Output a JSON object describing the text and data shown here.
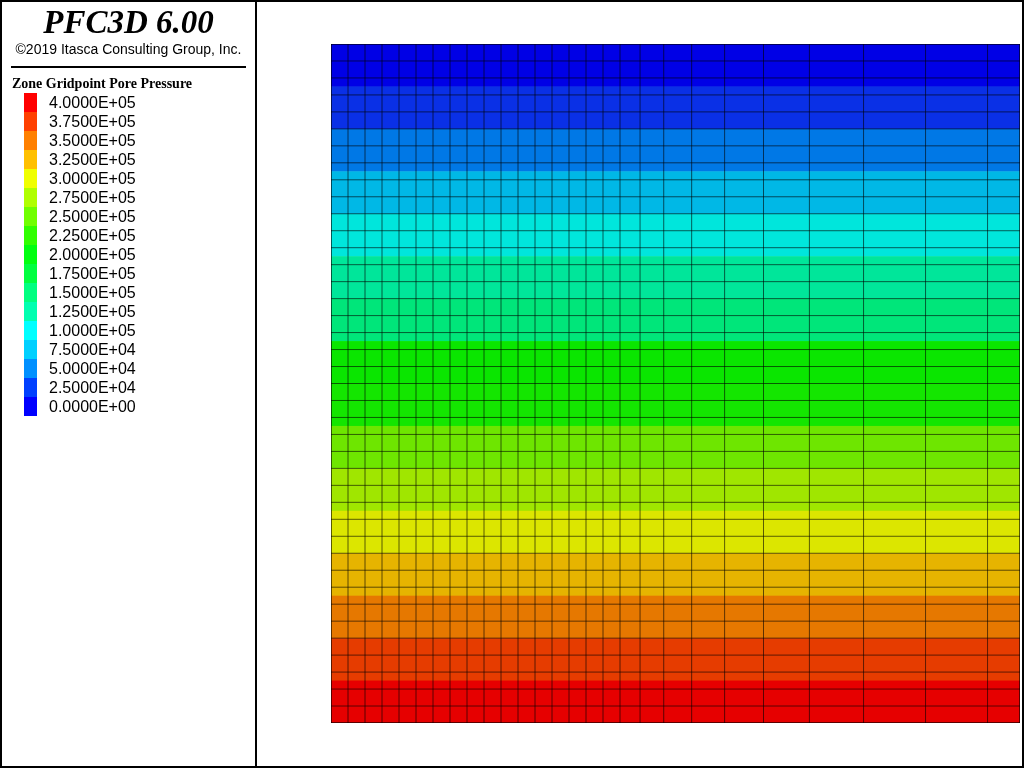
{
  "header": {
    "title": "PFC3D 6.00",
    "copyright": "©2019 Itasca Consulting Group, Inc."
  },
  "legend": {
    "title": "Zone Gridpoint Pore Pressure",
    "items": [
      {
        "label": "4.0000E+05",
        "color": "#ff0000"
      },
      {
        "label": "3.7500E+05",
        "color": "#ff4000"
      },
      {
        "label": "3.5000E+05",
        "color": "#ff8000"
      },
      {
        "label": "3.2500E+05",
        "color": "#ffc000"
      },
      {
        "label": "3.0000E+05",
        "color": "#f0ff00"
      },
      {
        "label": "2.7500E+05",
        "color": "#b0ff00"
      },
      {
        "label": "2.5000E+05",
        "color": "#70ff00"
      },
      {
        "label": "2.2500E+05",
        "color": "#30ff00"
      },
      {
        "label": "2.0000E+05",
        "color": "#00ff10"
      },
      {
        "label": "1.7500E+05",
        "color": "#00ff40"
      },
      {
        "label": "1.5000E+05",
        "color": "#00ff80"
      },
      {
        "label": "1.2500E+05",
        "color": "#00ffb0"
      },
      {
        "label": "1.0000E+05",
        "color": "#00ffff"
      },
      {
        "label": "7.5000E+04",
        "color": "#00d0ff"
      },
      {
        "label": "5.0000E+04",
        "color": "#0090ff"
      },
      {
        "label": "2.5000E+04",
        "color": "#0040ff"
      },
      {
        "label": "0.0000E+00",
        "color": "#0000ff"
      }
    ]
  }
}
